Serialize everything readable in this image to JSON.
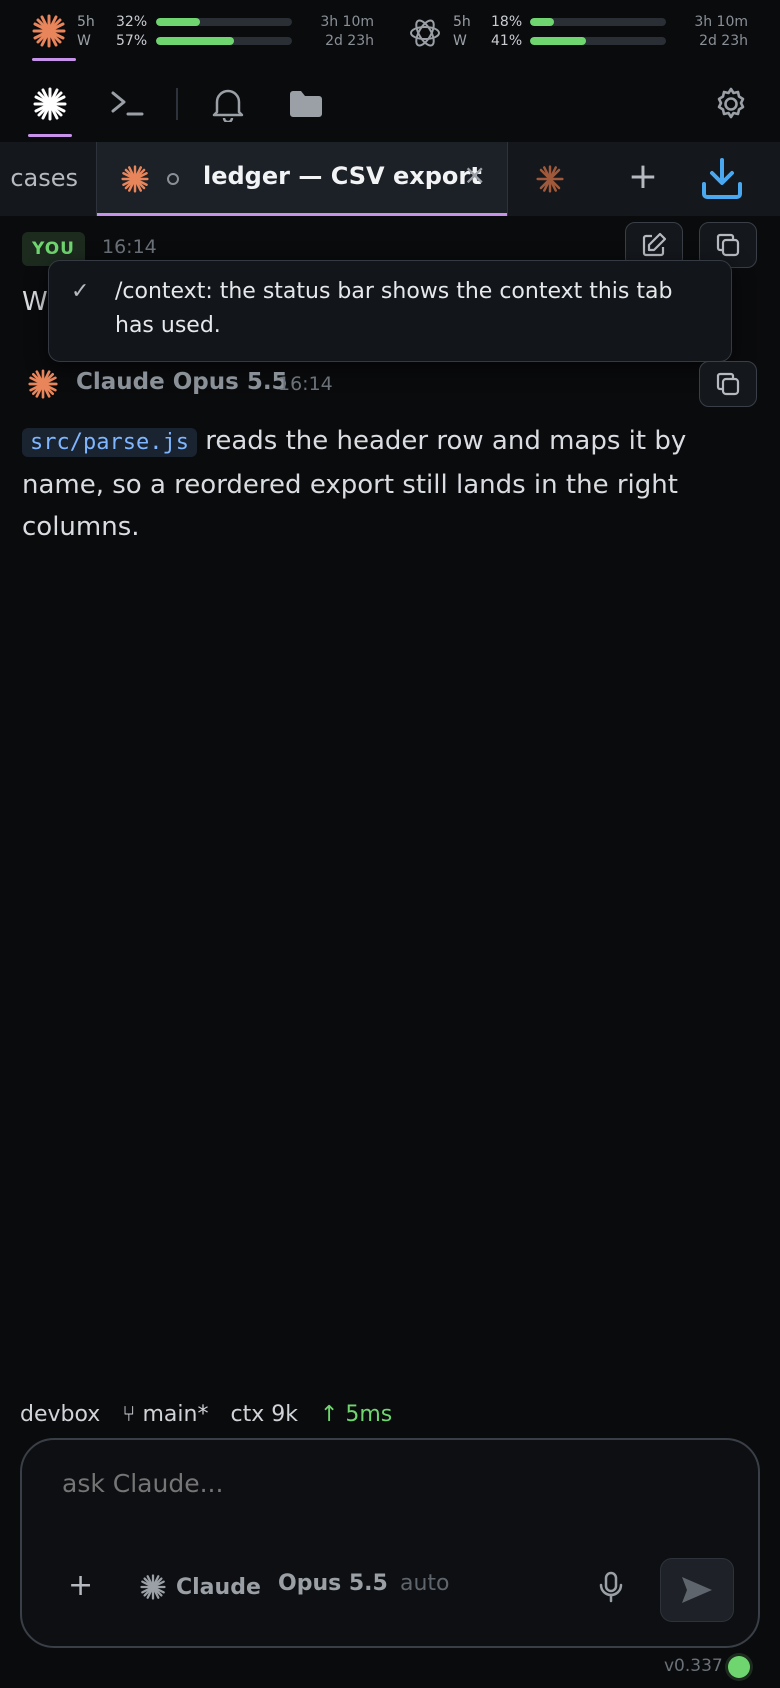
{
  "usage": {
    "claude": {
      "icon": "claude-starburst-icon",
      "rows": [
        {
          "period": "5h",
          "pct": "32%",
          "level": 0.32,
          "remaining": "3h 10m"
        },
        {
          "period": "W",
          "pct": "57%",
          "level": 0.57,
          "remaining": "2d 23h"
        }
      ]
    },
    "openai": {
      "icon": "openai-knot-icon",
      "rows": [
        {
          "period": "5h",
          "pct": "18%",
          "level": 0.18,
          "remaining": "3h 10m"
        },
        {
          "period": "W",
          "pct": "41%",
          "level": 0.41,
          "remaining": "2d 23h"
        }
      ]
    }
  },
  "nav": {
    "icons": [
      "claude-starburst-icon",
      "terminal-icon",
      "bell-icon",
      "folder-icon",
      "gear-icon"
    ]
  },
  "tabs": {
    "prev_label": "cases",
    "active_label": "ledger — CSV export",
    "close_glyph": "×",
    "add_glyph": "+"
  },
  "message_user": {
    "badge": "YOU",
    "time": "16:14",
    "text_visible": "W"
  },
  "toast": {
    "check": "✓",
    "text": "/context: the status bar shows the context this tab has used."
  },
  "message_assistant": {
    "name": "Claude Opus 5.5",
    "time": "16:14",
    "code": "src/parse.js",
    "text": " reads the header row and maps it by name, so a reordered export still lands in the right columns."
  },
  "status": {
    "host": "devbox",
    "branch": "⑂ main*",
    "ctx": "ctx 9k",
    "latency": "↑ 5ms"
  },
  "composer": {
    "placeholder": "ask Claude...",
    "add_glyph": "+",
    "agent": "Claude",
    "model": "Opus 5.5",
    "mode": "auto"
  },
  "footer": {
    "version": "v0.337"
  },
  "colors": {
    "accent_purple": "#c792ea",
    "claude_orange": "#e8855a",
    "green": "#6fd66f",
    "download_blue": "#4aa8f0"
  }
}
